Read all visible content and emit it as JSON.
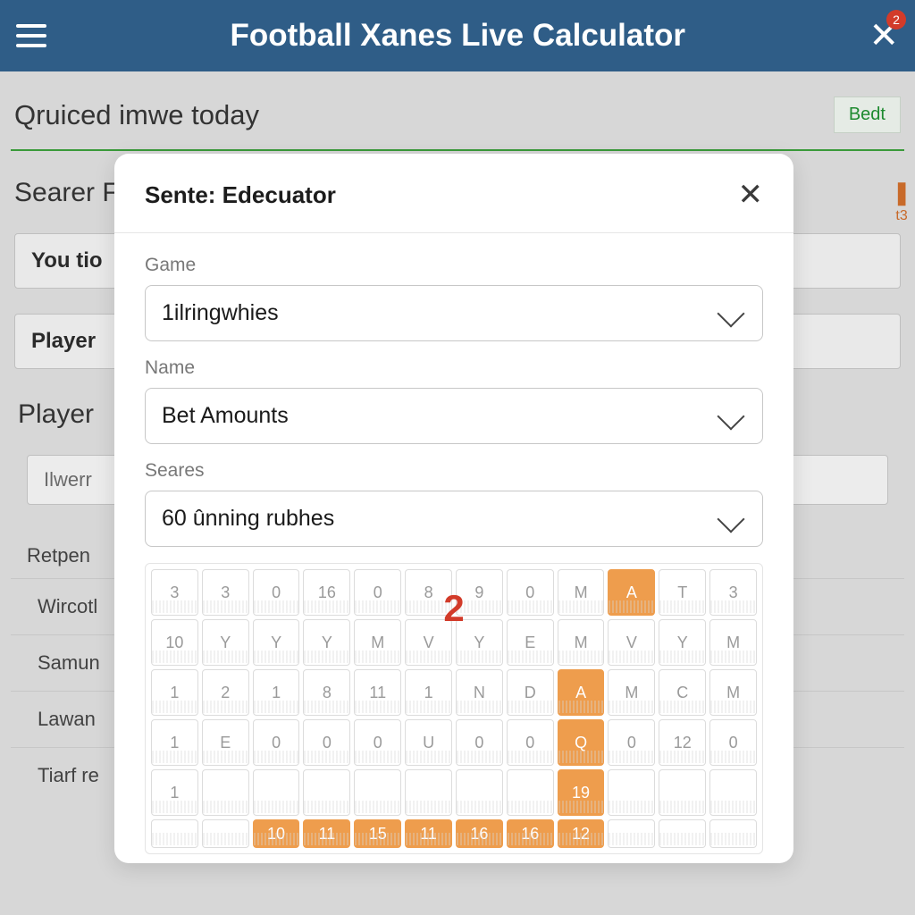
{
  "header": {
    "title": "Football Xanes Live Calculator",
    "badge": "2"
  },
  "page": {
    "section_title": "Qruiced imwe today",
    "bedt": "Bedt",
    "searer": "Searer F",
    "rows": {
      "you": "You tio",
      "player": "Player"
    },
    "player_h": "Player",
    "grey_input": "Ilwerr",
    "list_label": "Retpen",
    "list": [
      "Wircotl",
      "Samun",
      "Lawan",
      "Tiarf re"
    ]
  },
  "sidebar": {
    "bulb": "●",
    "sub": "t3"
  },
  "modal": {
    "title": "Sente: Edecuator",
    "fields": {
      "game": {
        "label": "Game",
        "value": "1ilringwhies"
      },
      "name": {
        "label": "Name",
        "value": "Bet Amounts"
      },
      "seares": {
        "label": "Seares",
        "value": "60 ûnning rubhes"
      }
    },
    "big_two": "2",
    "grid": [
      [
        {
          "t": "3"
        },
        {
          "t": "3"
        },
        {
          "t": "0"
        },
        {
          "t": "16"
        },
        {
          "t": "0"
        },
        {
          "t": "8"
        },
        {
          "t": "9"
        },
        {
          "t": "0"
        },
        {
          "t": "M"
        },
        {
          "t": "A",
          "sel": true
        },
        {
          "t": "T"
        },
        {
          "t": "3"
        }
      ],
      [
        {
          "t": "10"
        },
        {
          "t": "Y"
        },
        {
          "t": "Y"
        },
        {
          "t": "Y"
        },
        {
          "t": "M"
        },
        {
          "t": "V"
        },
        {
          "t": "Y"
        },
        {
          "t": "E"
        },
        {
          "t": "M"
        },
        {
          "t": "V"
        },
        {
          "t": "Y"
        },
        {
          "t": "M"
        }
      ],
      [
        {
          "t": "1"
        },
        {
          "t": "2"
        },
        {
          "t": "1"
        },
        {
          "t": "8"
        },
        {
          "t": "11"
        },
        {
          "t": "1"
        },
        {
          "t": "N"
        },
        {
          "t": "D"
        },
        {
          "t": "A",
          "sel": true
        },
        {
          "t": "M"
        },
        {
          "t": "C"
        },
        {
          "t": "M"
        }
      ],
      [
        {
          "t": "1"
        },
        {
          "t": "E"
        },
        {
          "t": "0"
        },
        {
          "t": "0"
        },
        {
          "t": "0"
        },
        {
          "t": "U"
        },
        {
          "t": "0"
        },
        {
          "t": "0"
        },
        {
          "t": "Q",
          "sel": true
        },
        {
          "t": "0"
        },
        {
          "t": "12"
        },
        {
          "t": "0"
        }
      ],
      [
        {
          "t": "1"
        },
        {
          "t": ""
        },
        {
          "t": ""
        },
        {
          "t": ""
        },
        {
          "t": ""
        },
        {
          "t": ""
        },
        {
          "t": ""
        },
        {
          "t": ""
        },
        {
          "t": "19",
          "sel": true
        },
        {
          "t": ""
        },
        {
          "t": ""
        },
        {
          "t": ""
        }
      ],
      [
        {
          "t": ""
        },
        {
          "t": ""
        },
        {
          "t": "10",
          "sel": true
        },
        {
          "t": "11",
          "sel": true
        },
        {
          "t": "15",
          "sel": true
        },
        {
          "t": "11",
          "sel": true
        },
        {
          "t": "16",
          "sel": true
        },
        {
          "t": "16",
          "sel": true
        },
        {
          "t": "12",
          "sel": true
        },
        {
          "t": ""
        },
        {
          "t": ""
        },
        {
          "t": ""
        }
      ]
    ]
  }
}
